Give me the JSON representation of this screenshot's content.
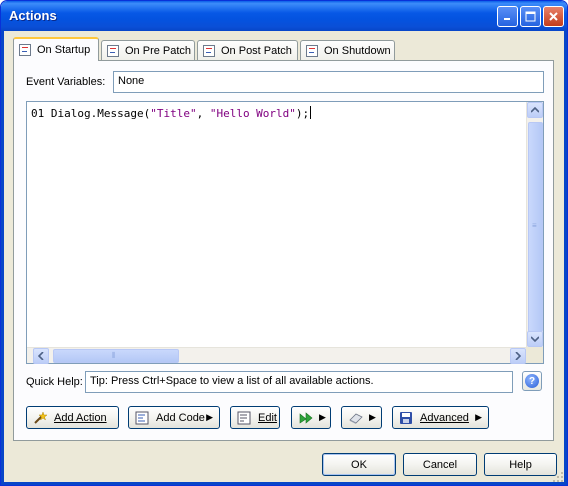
{
  "window": {
    "title": "Actions"
  },
  "tabs": [
    {
      "label": "On Startup",
      "active": true
    },
    {
      "label": "On Pre Patch",
      "active": false
    },
    {
      "label": "On Post Patch",
      "active": false
    },
    {
      "label": "On Shutdown",
      "active": false
    }
  ],
  "event_variables": {
    "label": "Event Variables:",
    "value": "None"
  },
  "editor": {
    "line_number": "01",
    "code_prefix": "Dialog.Message(",
    "string1": "\"Title\"",
    "separator": ", ",
    "string2": "\"Hello World\"",
    "code_suffix": ");"
  },
  "quick_help": {
    "label": "Quick Help:",
    "text": "Tip: Press Ctrl+Space to view a list of all available actions.",
    "help_glyph": "?"
  },
  "action_buttons": {
    "add_action": "Add Action",
    "add_code": "Add Code",
    "edit": "Edit",
    "advanced": "Advanced"
  },
  "dialog_buttons": {
    "ok": "OK",
    "cancel": "Cancel",
    "help": "Help"
  },
  "colors": {
    "titlebar": "#0758e6",
    "active_tab_accent": "#ffc73c",
    "string_literal": "#800080"
  }
}
